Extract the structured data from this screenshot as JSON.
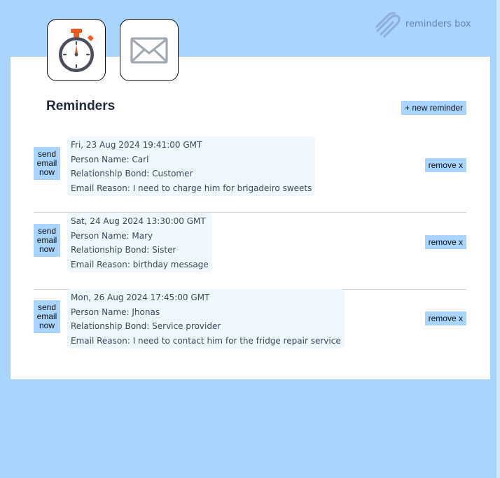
{
  "brand": {
    "name": "reminders box"
  },
  "header": {
    "timer_button_icon": "stopwatch-icon",
    "mail_button_icon": "envelope-icon"
  },
  "colors": {
    "background": "#a9d4fe",
    "accent_button": "#a9d4fe",
    "card": "#ffffff",
    "info_box": "#eff7ff"
  },
  "main": {
    "title": "Reminders",
    "new_reminder_label": "+ new reminder",
    "reminders": [
      {
        "send_label": [
          "send",
          "email",
          "now"
        ],
        "date": "Fri, 23 Aug 2024 19:41:00 GMT",
        "person": "Person Name: Carl",
        "bond": "Relationship Bond: Customer",
        "reason": "Email Reason: I need to charge him for brigadeiro sweets",
        "remove_label": "remove x"
      },
      {
        "send_label": [
          "send",
          "email",
          "now"
        ],
        "date": "Sat, 24 Aug 2024 13:30:00 GMT",
        "person": "Person Name: Mary",
        "bond": "Relationship Bond: Sister",
        "reason": "Email Reason: birthday message",
        "remove_label": "remove x"
      },
      {
        "send_label": [
          "send",
          "email",
          "now"
        ],
        "date": "Mon, 26 Aug 2024 17:45:00 GMT",
        "person": "Person Name: Jhonas",
        "bond": "Relationship Bond: Service provider",
        "reason": "Email Reason: I need to contact him for the fridge repair service",
        "remove_label": "remove x"
      }
    ]
  }
}
